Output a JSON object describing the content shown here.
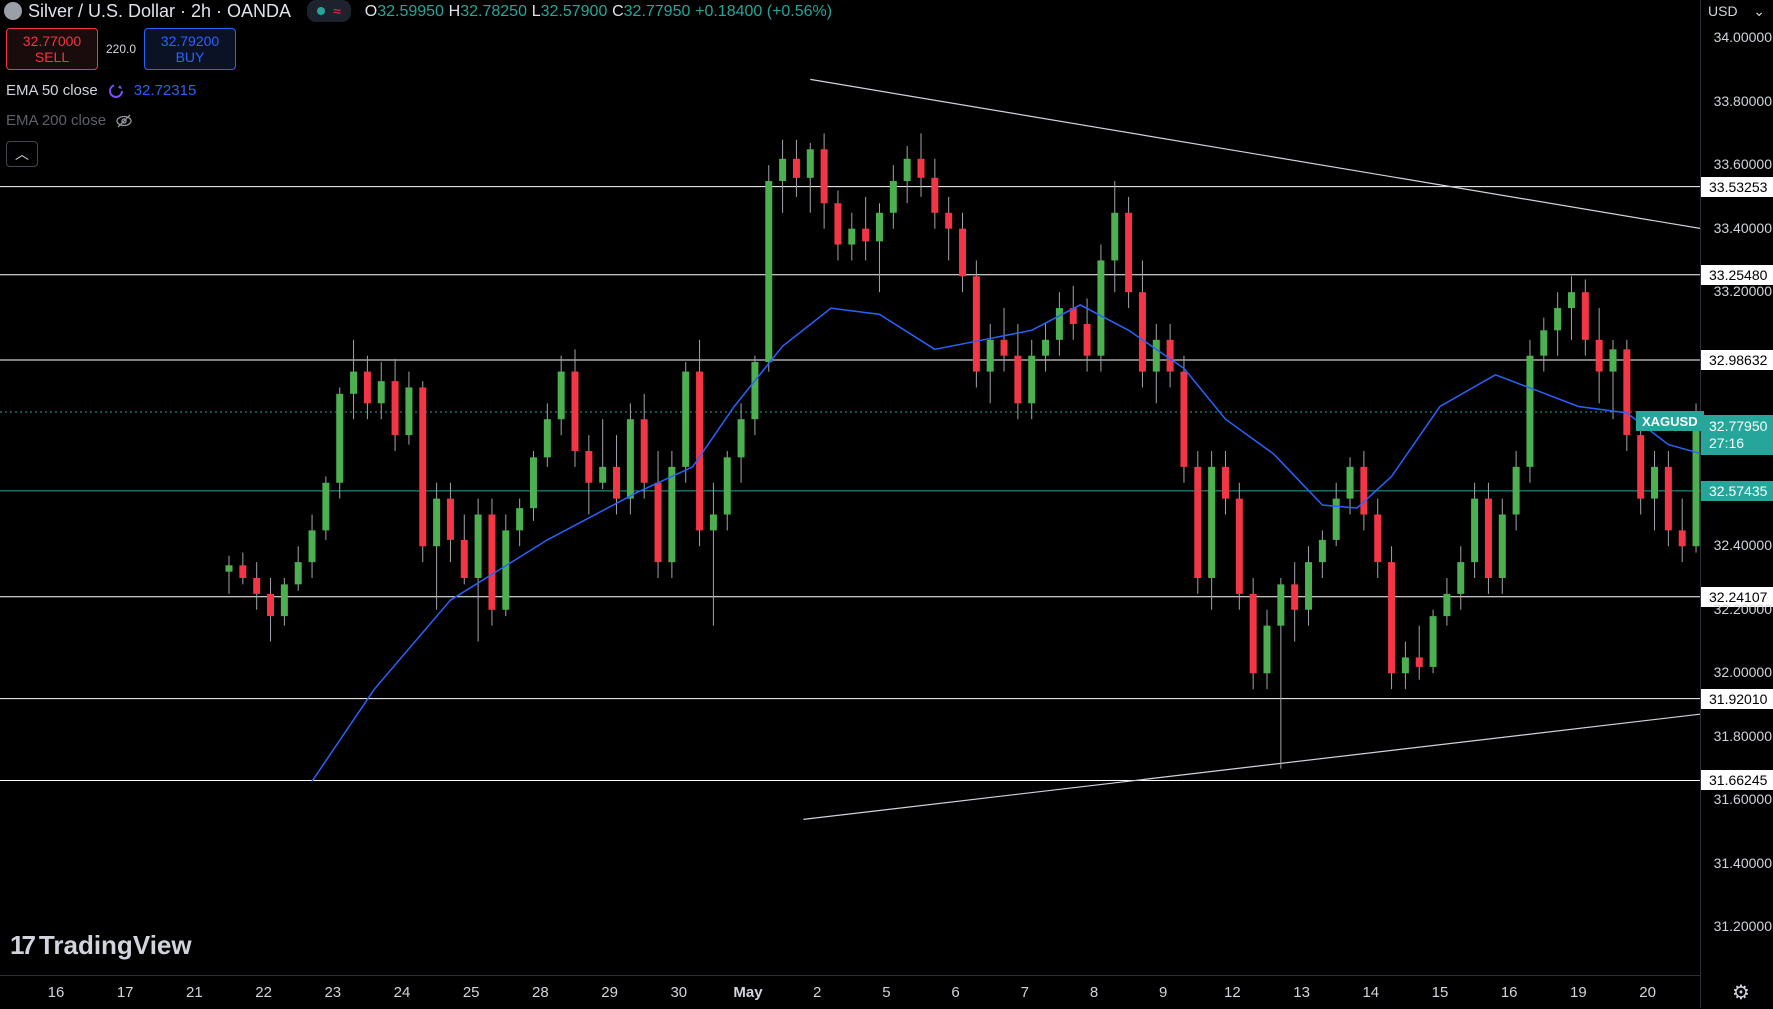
{
  "header": {
    "symbol_title": "Silver / U.S. Dollar · 2h · OANDA",
    "status_icon": "market-open-dot",
    "ohlc": {
      "o_label": "O",
      "o": "32.59950",
      "h_label": "H",
      "h": "32.78250",
      "l_label": "L",
      "l": "32.57900",
      "c_label": "C",
      "c": "32.77950",
      "change": "+0.18400 (+0.56%)"
    }
  },
  "trade": {
    "sell_price": "32.77000",
    "sell_label": "SELL",
    "spread": "220.0",
    "buy_price": "32.79200",
    "buy_label": "BUY"
  },
  "indicators": {
    "ema50_label": "EMA 50 close",
    "ema50_value": "32.72315",
    "ema200_label": "EMA 200 close"
  },
  "currency": "USD",
  "logo_text": "TradingView",
  "colors": {
    "up": "#4caf50",
    "down": "#f23645",
    "ema": "#2962ff",
    "level": "#ffffff",
    "accent": "#26a69a"
  },
  "chart_data": {
    "type": "candlestick",
    "symbol": "XAGUSD",
    "timeframe": "2h",
    "ylim": [
      31.05,
      34.12
    ],
    "price_ticks": [
      "34.00000",
      "33.80000",
      "33.60000",
      "33.40000",
      "33.20000",
      "32.40000",
      "32.20000",
      "32.00000",
      "31.80000",
      "31.60000",
      "31.40000",
      "31.20000"
    ],
    "time_ticks": [
      "16",
      "17",
      "21",
      "22",
      "23",
      "24",
      "25",
      "28",
      "29",
      "30",
      "May",
      "2",
      "5",
      "6",
      "7",
      "8",
      "9",
      "12",
      "13",
      "14",
      "15",
      "16",
      "19",
      "20"
    ],
    "horizontal_levels": [
      "33.53253",
      "33.25480",
      "32.98632",
      "32.57435",
      "32.24107",
      "31.92010",
      "31.66245"
    ],
    "current_price": "32.77950",
    "countdown": "27:16",
    "last_candle": {
      "o": 32.5995,
      "h": 32.7825,
      "l": 32.579,
      "c": 32.7795
    },
    "ema50_last": 32.72315,
    "trendlines": [
      {
        "from": [
          0.9,
          33.87
        ],
        "to": [
          23.1,
          33.06
        ]
      },
      {
        "from": [
          0.8,
          31.54
        ],
        "to": [
          23.1,
          32.11
        ]
      }
    ],
    "ema50_path": [
      [
        -6.3,
        31.66
      ],
      [
        -5.4,
        31.95
      ],
      [
        -4.3,
        32.23
      ],
      [
        -2.9,
        32.42
      ],
      [
        -1.6,
        32.57
      ],
      [
        -0.8,
        32.65
      ],
      [
        -0.2,
        32.84
      ],
      [
        0.5,
        33.03
      ],
      [
        1.2,
        33.15
      ],
      [
        1.9,
        33.13
      ],
      [
        2.7,
        33.02
      ],
      [
        3.4,
        33.05
      ],
      [
        4.1,
        33.08
      ],
      [
        4.8,
        33.16
      ],
      [
        5.5,
        33.08
      ],
      [
        6.3,
        32.96
      ],
      [
        6.9,
        32.8
      ],
      [
        7.6,
        32.69
      ],
      [
        8.3,
        32.53
      ],
      [
        8.8,
        32.52
      ],
      [
        9.3,
        32.62
      ],
      [
        10.0,
        32.84
      ],
      [
        10.8,
        32.94
      ],
      [
        11.4,
        32.89
      ],
      [
        12.0,
        32.84
      ],
      [
        12.7,
        32.82
      ],
      [
        13.3,
        32.72
      ],
      [
        13.8,
        32.69
      ],
      [
        14.6,
        32.72
      ],
      [
        15.2,
        32.65
      ],
      [
        15.8,
        32.75
      ],
      [
        16.4,
        32.82
      ],
      [
        17.0,
        32.78
      ],
      [
        17.4,
        32.76
      ]
    ],
    "candles": [
      [
        -7.5,
        32.32,
        32.37,
        32.25,
        32.34
      ],
      [
        -7.3,
        32.34,
        32.38,
        32.28,
        32.3
      ],
      [
        -7.1,
        32.3,
        32.35,
        32.2,
        32.25
      ],
      [
        -6.9,
        32.25,
        32.3,
        32.1,
        32.18
      ],
      [
        -6.7,
        32.18,
        32.3,
        32.15,
        32.28
      ],
      [
        -6.5,
        32.28,
        32.4,
        32.26,
        32.35
      ],
      [
        -6.3,
        32.35,
        32.5,
        32.3,
        32.45
      ],
      [
        -6.1,
        32.45,
        32.62,
        32.42,
        32.6
      ],
      [
        -5.9,
        32.6,
        32.9,
        32.55,
        32.88
      ],
      [
        -5.7,
        32.88,
        33.05,
        32.8,
        32.95
      ],
      [
        -5.5,
        32.95,
        33.0,
        32.8,
        32.85
      ],
      [
        -5.3,
        32.85,
        32.98,
        32.8,
        32.92
      ],
      [
        -5.1,
        32.92,
        32.99,
        32.7,
        32.75
      ],
      [
        -4.9,
        32.75,
        32.95,
        32.72,
        32.9
      ],
      [
        -4.7,
        32.9,
        32.92,
        32.35,
        32.4
      ],
      [
        -4.5,
        32.4,
        32.6,
        32.2,
        32.55
      ],
      [
        -4.3,
        32.55,
        32.6,
        32.35,
        32.42
      ],
      [
        -4.1,
        32.42,
        32.5,
        32.28,
        32.3
      ],
      [
        -3.9,
        32.3,
        32.55,
        32.1,
        32.5
      ],
      [
        -3.7,
        32.5,
        32.55,
        32.15,
        32.2
      ],
      [
        -3.5,
        32.2,
        32.5,
        32.18,
        32.45
      ],
      [
        -3.3,
        32.45,
        32.55,
        32.4,
        32.52
      ],
      [
        -3.1,
        32.52,
        32.7,
        32.48,
        32.68
      ],
      [
        -2.9,
        32.68,
        32.85,
        32.65,
        32.8
      ],
      [
        -2.7,
        32.8,
        33.0,
        32.75,
        32.95
      ],
      [
        -2.5,
        32.95,
        33.02,
        32.65,
        32.7
      ],
      [
        -2.3,
        32.7,
        32.75,
        32.5,
        32.6
      ],
      [
        -2.1,
        32.6,
        32.8,
        32.58,
        32.65
      ],
      [
        -1.9,
        32.65,
        32.75,
        32.5,
        32.55
      ],
      [
        -1.7,
        32.55,
        32.85,
        32.5,
        32.8
      ],
      [
        -1.5,
        32.8,
        32.88,
        32.55,
        32.6
      ],
      [
        -1.3,
        32.6,
        32.7,
        32.3,
        32.35
      ],
      [
        -1.1,
        32.35,
        32.7,
        32.3,
        32.65
      ],
      [
        -0.9,
        32.65,
        32.98,
        32.6,
        32.95
      ],
      [
        -0.7,
        32.95,
        33.05,
        32.4,
        32.45
      ],
      [
        -0.5,
        32.45,
        32.6,
        32.15,
        32.5
      ],
      [
        -0.3,
        32.5,
        32.7,
        32.45,
        32.68
      ],
      [
        -0.1,
        32.68,
        32.85,
        32.6,
        32.8
      ],
      [
        0.1,
        32.8,
        33.0,
        32.75,
        32.98
      ],
      [
        0.3,
        32.98,
        33.6,
        32.95,
        33.55
      ],
      [
        0.5,
        33.55,
        33.68,
        33.45,
        33.62
      ],
      [
        0.7,
        33.62,
        33.68,
        33.5,
        33.56
      ],
      [
        0.9,
        33.56,
        33.67,
        33.45,
        33.65
      ],
      [
        1.1,
        33.65,
        33.7,
        33.4,
        33.48
      ],
      [
        1.3,
        33.48,
        33.52,
        33.3,
        33.35
      ],
      [
        1.5,
        33.35,
        33.45,
        33.3,
        33.4
      ],
      [
        1.7,
        33.4,
        33.5,
        33.3,
        33.36
      ],
      [
        1.9,
        33.36,
        33.48,
        33.2,
        33.45
      ],
      [
        2.1,
        33.45,
        33.6,
        33.4,
        33.55
      ],
      [
        2.3,
        33.55,
        33.66,
        33.48,
        33.62
      ],
      [
        2.5,
        33.62,
        33.7,
        33.5,
        33.56
      ],
      [
        2.7,
        33.56,
        33.62,
        33.4,
        33.45
      ],
      [
        2.9,
        33.45,
        33.5,
        33.3,
        33.4
      ],
      [
        3.1,
        33.4,
        33.45,
        33.2,
        33.25
      ],
      [
        3.3,
        33.25,
        33.3,
        32.9,
        32.95
      ],
      [
        3.5,
        32.95,
        33.1,
        32.85,
        33.05
      ],
      [
        3.7,
        33.05,
        33.15,
        32.95,
        33.0
      ],
      [
        3.9,
        33.0,
        33.1,
        32.8,
        32.85
      ],
      [
        4.1,
        32.85,
        33.05,
        32.8,
        33.0
      ],
      [
        4.3,
        33.0,
        33.1,
        32.95,
        33.05
      ],
      [
        4.5,
        33.05,
        33.2,
        33.0,
        33.15
      ],
      [
        4.7,
        33.15,
        33.22,
        33.05,
        33.1
      ],
      [
        4.9,
        33.1,
        33.18,
        32.95,
        33.0
      ],
      [
        5.1,
        33.0,
        33.35,
        32.95,
        33.3
      ],
      [
        5.3,
        33.3,
        33.55,
        33.2,
        33.45
      ],
      [
        5.5,
        33.45,
        33.5,
        33.15,
        33.2
      ],
      [
        5.7,
        33.2,
        33.3,
        32.9,
        32.95
      ],
      [
        5.9,
        32.95,
        33.1,
        32.85,
        33.05
      ],
      [
        6.1,
        33.05,
        33.1,
        32.9,
        32.95
      ],
      [
        6.3,
        32.95,
        33.0,
        32.6,
        32.65
      ],
      [
        6.5,
        32.65,
        32.7,
        32.25,
        32.3
      ],
      [
        6.7,
        32.3,
        32.7,
        32.2,
        32.65
      ],
      [
        6.9,
        32.65,
        32.7,
        32.5,
        32.55
      ],
      [
        7.1,
        32.55,
        32.6,
        32.2,
        32.25
      ],
      [
        7.3,
        32.25,
        32.3,
        31.95,
        32.0
      ],
      [
        7.5,
        32.0,
        32.2,
        31.95,
        32.15
      ],
      [
        7.7,
        32.15,
        32.3,
        31.7,
        32.28
      ],
      [
        7.9,
        32.28,
        32.35,
        32.1,
        32.2
      ],
      [
        8.1,
        32.2,
        32.4,
        32.15,
        32.35
      ],
      [
        8.3,
        32.35,
        32.45,
        32.3,
        32.42
      ],
      [
        8.5,
        32.42,
        32.6,
        32.4,
        32.55
      ],
      [
        8.7,
        32.55,
        32.68,
        32.5,
        32.65
      ],
      [
        8.9,
        32.65,
        32.7,
        32.45,
        32.5
      ],
      [
        9.1,
        32.5,
        32.55,
        32.3,
        32.35
      ],
      [
        9.3,
        32.35,
        32.4,
        31.95,
        32.0
      ],
      [
        9.5,
        32.0,
        32.1,
        31.95,
        32.05
      ],
      [
        9.7,
        32.05,
        32.15,
        31.98,
        32.02
      ],
      [
        9.9,
        32.02,
        32.2,
        32.0,
        32.18
      ],
      [
        10.1,
        32.18,
        32.3,
        32.15,
        32.25
      ],
      [
        10.3,
        32.25,
        32.4,
        32.2,
        32.35
      ],
      [
        10.5,
        32.35,
        32.6,
        32.3,
        32.55
      ],
      [
        10.7,
        32.55,
        32.6,
        32.25,
        32.3
      ],
      [
        10.9,
        32.3,
        32.55,
        32.25,
        32.5
      ],
      [
        11.1,
        32.5,
        32.7,
        32.45,
        32.65
      ],
      [
        11.3,
        32.65,
        33.05,
        32.6,
        33.0
      ],
      [
        11.5,
        33.0,
        33.12,
        32.95,
        33.08
      ],
      [
        11.7,
        33.08,
        33.2,
        33.0,
        33.15
      ],
      [
        11.9,
        33.15,
        33.25,
        33.05,
        33.2
      ],
      [
        12.1,
        33.2,
        33.24,
        33.0,
        33.05
      ],
      [
        12.3,
        33.05,
        33.15,
        32.85,
        32.95
      ],
      [
        12.5,
        32.95,
        33.05,
        32.8,
        33.02
      ],
      [
        12.7,
        33.02,
        33.05,
        32.7,
        32.75
      ],
      [
        12.9,
        32.75,
        32.8,
        32.5,
        32.55
      ],
      [
        13.1,
        32.55,
        32.7,
        32.45,
        32.65
      ],
      [
        13.3,
        32.65,
        32.7,
        32.4,
        32.45
      ],
      [
        13.5,
        32.45,
        32.55,
        32.35,
        32.4
      ],
      [
        13.7,
        32.4,
        32.85,
        32.38,
        32.8
      ],
      [
        13.9,
        32.8,
        32.85,
        32.4,
        32.45
      ],
      [
        14.1,
        32.45,
        32.55,
        32.3,
        32.35
      ],
      [
        14.3,
        32.35,
        32.5,
        32.25,
        32.45
      ],
      [
        14.5,
        32.45,
        32.7,
        32.4,
        32.5
      ],
      [
        14.7,
        32.5,
        32.6,
        32.4,
        32.45
      ],
      [
        14.9,
        32.45,
        32.6,
        32.35,
        32.55
      ],
      [
        15.1,
        32.55,
        32.7,
        32.5,
        32.65
      ],
      [
        15.3,
        32.65,
        32.8,
        32.6,
        32.75
      ],
      [
        15.5,
        32.75,
        32.82,
        32.55,
        32.6
      ],
      [
        15.7,
        32.6,
        32.7,
        32.5,
        32.62
      ],
      [
        15.9,
        32.62,
        33.0,
        32.58,
        32.95
      ],
      [
        16.1,
        32.95,
        33.0,
        31.95,
        32.0
      ],
      [
        16.3,
        32.0,
        32.65,
        31.98,
        32.6
      ],
      [
        16.5,
        32.6,
        32.65,
        32.4,
        32.45
      ],
      [
        16.7,
        32.45,
        32.6,
        32.4,
        32.55
      ],
      [
        16.9,
        32.55,
        32.7,
        32.5,
        32.65
      ],
      [
        17.1,
        32.65,
        32.9,
        32.6,
        32.85
      ],
      [
        17.3,
        32.85,
        33.15,
        32.8,
        33.1
      ],
      [
        17.5,
        33.1,
        33.23,
        33.0,
        33.15
      ],
      [
        17.7,
        33.15,
        33.2,
        32.8,
        32.85
      ],
      [
        17.9,
        32.85,
        33.0,
        32.6,
        32.95
      ],
      [
        18.1,
        32.95,
        33.0,
        32.8,
        32.9
      ],
      [
        18.3,
        32.9,
        32.98,
        32.75,
        32.8
      ],
      [
        18.5,
        32.8,
        32.85,
        32.6,
        32.65
      ],
      [
        18.7,
        32.5995,
        32.7825,
        32.579,
        32.7795
      ]
    ]
  }
}
